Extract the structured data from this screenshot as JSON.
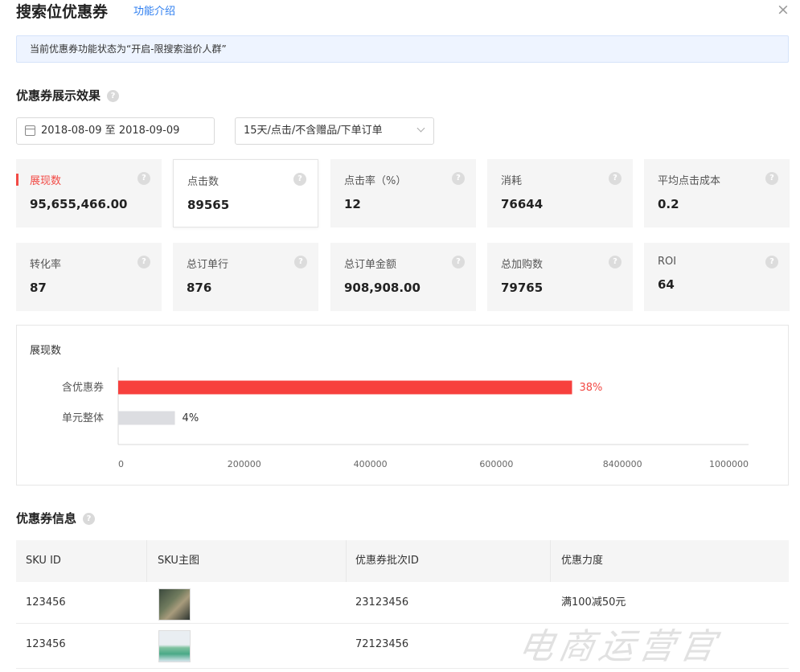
{
  "header": {
    "title": "搜索位优惠券",
    "intro_link": "功能介绍",
    "close_glyph": "×"
  },
  "notice": "当前优惠券功能状态为“开启-限搜索溢价人群”",
  "display_section": {
    "title": "优惠券展示效果",
    "date_range": "2018-08-09 至 2018-09-09",
    "attribution_select": "15天/点击/不含赠品/下单订单",
    "metrics": [
      {
        "label": "展现数",
        "value": "95,655,466.00",
        "active": true
      },
      {
        "label": "点击数",
        "value": "89565",
        "selected": true
      },
      {
        "label": "点击率（%）",
        "value": "12"
      },
      {
        "label": "消耗",
        "value": "76644"
      },
      {
        "label": "平均点击成本",
        "value": "0.2"
      },
      {
        "label": "转化率",
        "value": "87"
      },
      {
        "label": "总订单行",
        "value": "876"
      },
      {
        "label": "总订单金额",
        "value": "908,908.00"
      },
      {
        "label": "总加购数",
        "value": "79765"
      },
      {
        "label": "ROI",
        "value": "64"
      }
    ]
  },
  "chart_data": {
    "type": "bar",
    "orientation": "horizontal",
    "title": "展现数",
    "categories": [
      "含优惠券",
      "单元整体"
    ],
    "values": [
      720000,
      90000
    ],
    "value_labels": [
      "38%",
      "4%"
    ],
    "x_tick_labels": [
      "0",
      "200000",
      "400000",
      "600000",
      "8400000",
      "1000000"
    ],
    "xlim": [
      0,
      1000000
    ],
    "colors": [
      "#f7403d",
      "#dcdde1"
    ],
    "label_colors": [
      "#f24a45",
      "#333333"
    ],
    "grid": false
  },
  "coupon_section": {
    "title": "优惠券信息",
    "columns": [
      "SKU ID",
      "SKU主图",
      "优惠券批次ID",
      "优惠力度"
    ],
    "rows": [
      {
        "sku_id": "123456",
        "batch_id": "23123456",
        "discount": "满100减50元"
      },
      {
        "sku_id": "123456",
        "batch_id": "72123456",
        "discount": ""
      }
    ]
  },
  "watermark": "电商运营官"
}
